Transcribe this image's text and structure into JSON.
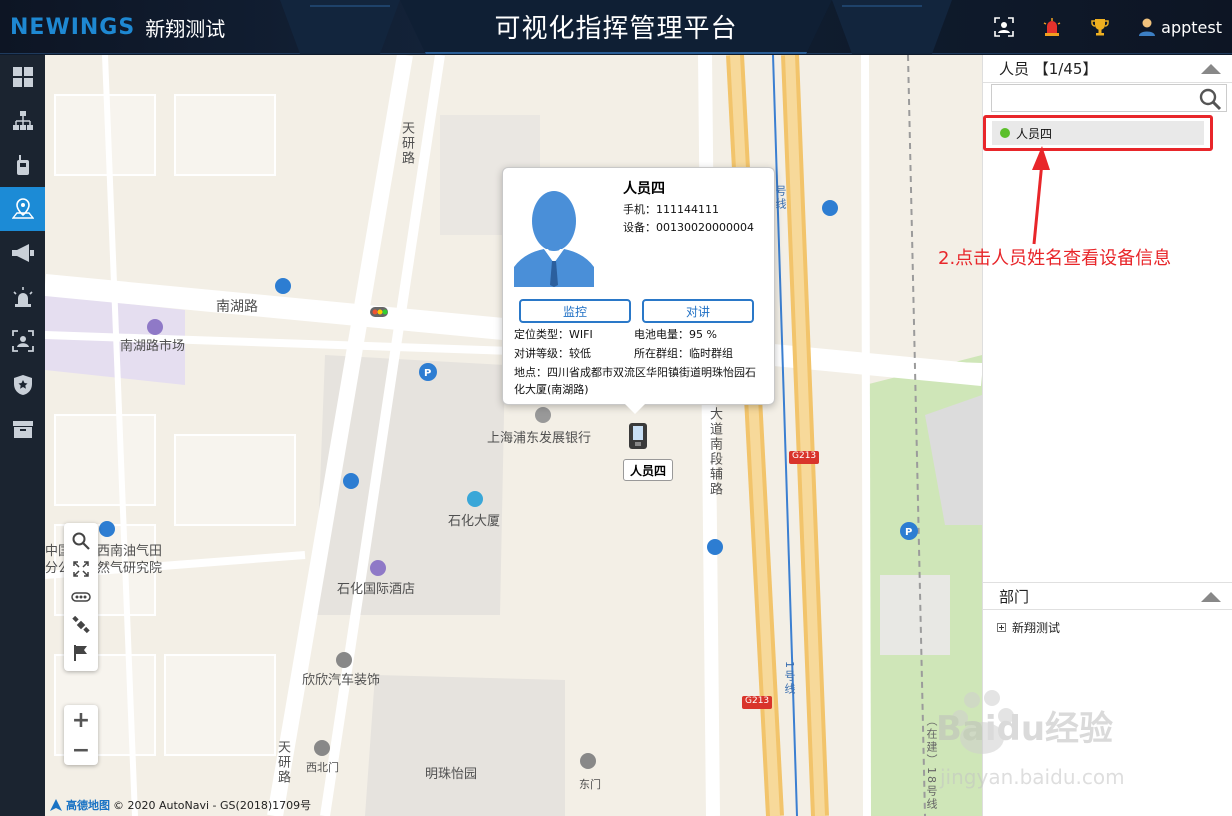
{
  "header": {
    "logo_mark": "NEWINGS",
    "logo_text": "新翔测试",
    "title": "可视化指挥管理平台",
    "username": "apptest"
  },
  "sidebar": {
    "items": [
      {
        "icon": "dashboard-icon"
      },
      {
        "icon": "org-tree-icon"
      },
      {
        "icon": "walkie-talkie-icon"
      },
      {
        "icon": "map-location-icon",
        "active": true
      },
      {
        "icon": "broadcast-icon"
      },
      {
        "icon": "alarm-icon"
      },
      {
        "icon": "face-scan-icon"
      },
      {
        "icon": "shield-icon"
      },
      {
        "icon": "archive-icon"
      }
    ]
  },
  "map": {
    "labels": {
      "tianyan_road_top": "天研路",
      "nanhu_road": "南湖路",
      "nanhu_market": "南湖路市场",
      "bank": "上海浦东发展银行",
      "shihua_building": "石化大厦",
      "zhongguo": "中国",
      "fengong": "分公",
      "petro_institute_1": "西南油气田",
      "petro_institute_2": "然气研究院",
      "shihua_hotel": "石化国际酒店",
      "auto_decor": "欣欣汽车装饰",
      "tianyan_road_bottom": "天研路",
      "west_north_gate": "西北门",
      "mingzhu_garden": "明珠怡园",
      "east_gate": "东门",
      "avenue": "大道南段辅路",
      "g213_a": "G213",
      "g213_b": "G213",
      "line1": "1号线",
      "line1_top": "号线",
      "under_construction": "（在建）18号线"
    },
    "copyright_brand": "高德地图",
    "copyright": "© 2020 AutoNavi - GS(2018)1709号"
  },
  "popup": {
    "name": "人员四",
    "phone_label": "手机：",
    "phone": "111144111",
    "device_label": "设备：",
    "device": "00130020000004",
    "btn_monitor": "监控",
    "btn_talk": "对讲",
    "loc_type": "定位类型：WIFI",
    "battery": "电池电量：95 %",
    "talk_level": "对讲等级：较低",
    "group": "所在群组：临时群组",
    "address": "地点：四川省成都市双流区华阳镇街道明珠怡园石化大厦(南湖路)"
  },
  "marker": {
    "label": "人员四"
  },
  "right_panel": {
    "people_title": "人员 【1/45】",
    "search_placeholder": "",
    "people": [
      {
        "name": "人员四",
        "online": true
      }
    ],
    "dept_title": "部门",
    "depts": [
      {
        "name": "新翔测试"
      }
    ]
  },
  "annotation": "2.点击人员姓名查看设备信息",
  "watermark": {
    "brand": "Baidu经验",
    "url": "jingyan.baidu.com"
  },
  "colors": {
    "accent": "#1c8bd6",
    "online": "#5bbf2a",
    "annotation": "#e8262a"
  }
}
